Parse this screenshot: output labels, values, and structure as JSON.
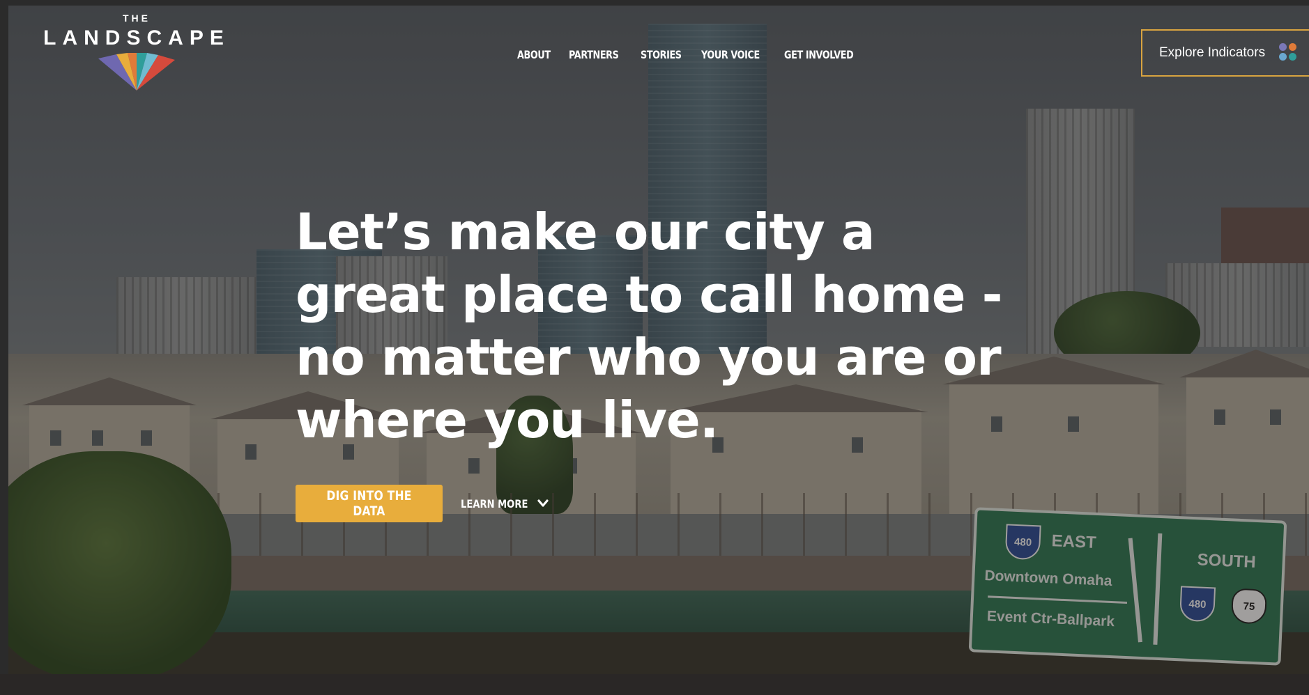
{
  "logo": {
    "the": "THE",
    "wordmark": "LANDSCAPE",
    "fan_colors": [
      "#6f68b0",
      "#e8ad3c",
      "#e07b39",
      "#2f9e9a",
      "#70bcd1",
      "#d64a3c"
    ]
  },
  "nav": {
    "items": [
      {
        "label": "ABOUT"
      },
      {
        "label": "PARTNERS"
      },
      {
        "label": "STORIES"
      },
      {
        "label": "YOUR VOICE"
      },
      {
        "label": "GET INVOLVED"
      }
    ]
  },
  "explore": {
    "label": "Explore Indicators",
    "border_color": "#d9a440",
    "dot_colors": [
      "#7a78b8",
      "#e07b39",
      "#6aa7cf",
      "#2f9e9a"
    ]
  },
  "hero": {
    "lines": [
      "Let’s make our city a",
      "great place to call home -",
      "no matter who you are or",
      "where you live."
    ],
    "primary_cta": "DIG INTO THE DATA",
    "secondary_cta": "LEARN MORE",
    "cta_color": "#e8ad3c"
  },
  "background_sign": {
    "route_interstate": "480",
    "route_us": "75",
    "east": "EAST",
    "south": "SOUTH",
    "line1": "Downtown Omaha",
    "line2": "Event Ctr-Ballpark"
  },
  "icons": {
    "chevron": "chevron-down-icon",
    "grid_dots": "dots-grid-icon",
    "fan": "landscape-fan-logo"
  }
}
